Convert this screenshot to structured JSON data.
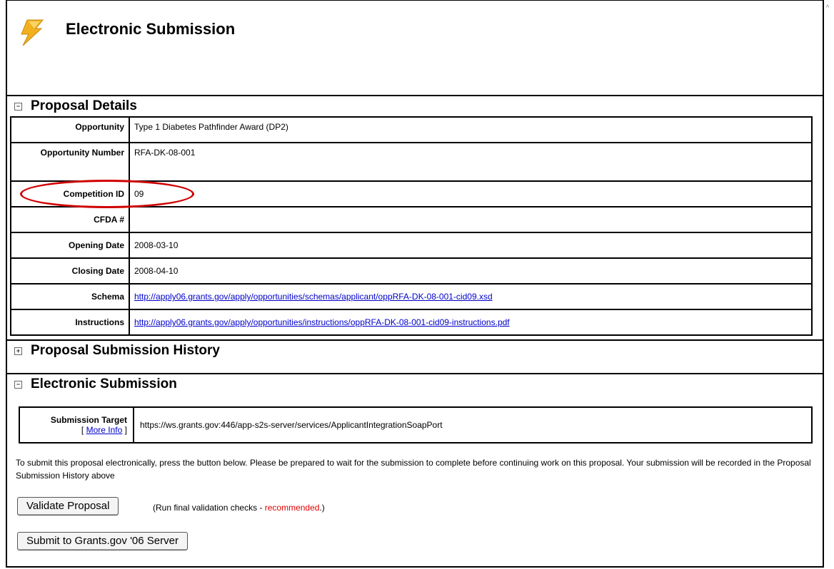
{
  "header": {
    "title": "Electronic Submission",
    "icon": "lightning-bolt-icon"
  },
  "proposal_details": {
    "heading": "Proposal Details",
    "rows": [
      {
        "label": "Opportunity",
        "value": "Type 1 Diabetes Pathfinder Award (DP2)"
      },
      {
        "label": "Opportunity Number",
        "value": "RFA-DK-08-001"
      },
      {
        "label": "Competition ID",
        "value": "09"
      },
      {
        "label": "CFDA #",
        "value": ""
      },
      {
        "label": "Opening Date",
        "value": "2008-03-10"
      },
      {
        "label": "Closing Date",
        "value": "2008-04-10"
      },
      {
        "label": "Schema",
        "value": "http://apply06.grants.gov/apply/opportunities/schemas/applicant/oppRFA-DK-08-001-cid09.xsd"
      },
      {
        "label": "Instructions",
        "value": "http://apply06.grants.gov/apply/opportunities/instructions/oppRFA-DK-08-001-cid09-instructions.pdf"
      }
    ]
  },
  "history": {
    "heading": "Proposal Submission History"
  },
  "electronic": {
    "heading": "Electronic Submission",
    "target_label": "Submission Target",
    "more_info_open": "[",
    "more_info": "More Info",
    "more_info_close": "]",
    "target_value": "https://ws.grants.gov:446/app-s2s-server/services/ApplicantIntegrationSoapPort",
    "instructions": "To submit this proposal electronically, press the button below. Please be prepared to wait for the submission to complete before continuing work on this proposal. Your submission will be recorded in the Proposal Submission History above",
    "validate_button": "Validate Proposal",
    "validate_note_prefix": "(Run final validation checks - ",
    "validate_note_highlight": "recommended",
    "validate_note_suffix": ".)",
    "submit_button": "Submit to Grants.gov '06 Server"
  },
  "colors": {
    "link": "#0000cc",
    "highlight": "#e00000",
    "annotation": "#d00000",
    "bolt": "#f2b01e"
  }
}
